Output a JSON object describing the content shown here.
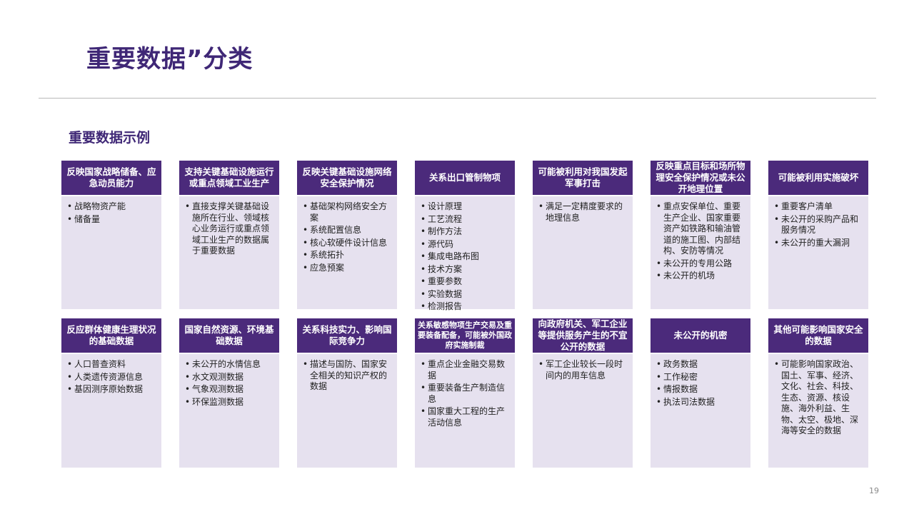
{
  "title": "重要数据”分类",
  "subtitle": "重要数据示例",
  "page_number": "19",
  "colors": {
    "accent": "#4b2a7b",
    "card_bg": "#e6e1ef",
    "title": "#3f2776"
  },
  "row1": [
    {
      "heading": "反映国家战略储备、应急动员能力",
      "items": [
        "战略物资产能",
        "储备量"
      ]
    },
    {
      "heading": "支持关键基础设施运行或重点领域工业生产",
      "items": [
        "直接支撑关键基础设施所在行业、领域核心业务运行或重点领域工业生产的数据属于重要数据"
      ]
    },
    {
      "heading": "反映关键基础设施网络安全保护情况",
      "items": [
        "基础架构网络安全方案",
        "系统配置信息",
        "核心软硬件设计信息",
        "系统拓扑",
        "应急预案"
      ]
    },
    {
      "heading": "关系出口管制物项",
      "items": [
        "设计原理",
        "工艺流程",
        "制作方法",
        "源代码",
        "集成电路布图",
        "技术方案",
        "重要参数",
        "实验数据",
        "检测报告"
      ]
    },
    {
      "heading": "可能被利用对我国发起军事打击",
      "items": [
        "满足一定精度要求的地理信息"
      ]
    },
    {
      "heading": "反映重点目标和场所物理安全保护情况或未公开地理位置",
      "items": [
        "重点安保单位、重要生产企业、国家重要资产如铁路和输油管道的施工图、内部结构、安防等情况",
        "未公开的专用公路",
        "未公开的机场"
      ]
    },
    {
      "heading": "可能被利用实施破坏",
      "items": [
        "重要客户清单",
        "未公开的采购产品和服务情况",
        "未公开的重大漏洞"
      ]
    }
  ],
  "row2": [
    {
      "heading": "反应群体健康生理状况的基础数据",
      "items": [
        "人口普查资料",
        "人类遗传资源信息",
        "基因测序原始数据"
      ]
    },
    {
      "heading": "国家自然资源、环境基础数据",
      "items": [
        "未公开的水情信息",
        "水文观测数据",
        "气象观测数据",
        "环保监测数据"
      ]
    },
    {
      "heading": "关系科技实力、影响国际竞争力",
      "items": [
        "描述与国防、国家安全相关的知识产权的数据"
      ]
    },
    {
      "heading": "关系敏感物项生产交易及重要装备配备，可能被外国政府实施制裁",
      "items": [
        "重点企业金融交易数据",
        "重要装备生产制造信息",
        "国家重大工程的生产活动信息"
      ]
    },
    {
      "heading": "向政府机关、军工企业等提供服务产生的不宜公开的数据",
      "items": [
        "军工企业较长一段时间内的用车信息"
      ]
    },
    {
      "heading": "未公开的机密",
      "items": [
        "政务数据",
        "工作秘密",
        "情报数据",
        "执法司法数据"
      ]
    },
    {
      "heading": "其他可能影响国家安全的数据",
      "items": [
        "可能影响国家政治、国土、军事、经济、文化、社会、科技、生态、资源、核设施、海外利益、生物、太空、极地、深海等安全的数据"
      ]
    }
  ]
}
